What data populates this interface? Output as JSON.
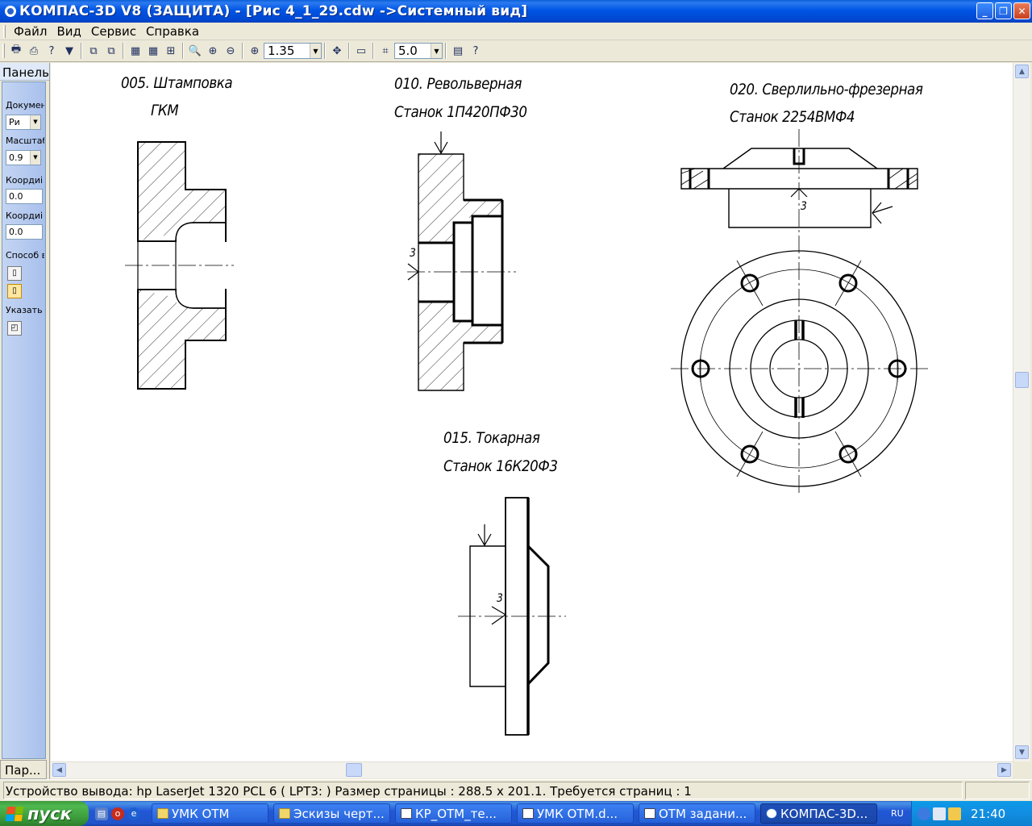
{
  "window": {
    "title": "КОМПАС-3D V8 (ЗАЩИТА) - [Рис 4_1_29.cdw ->Системный вид]"
  },
  "menu": [
    "Файл",
    "Вид",
    "Сервис",
    "Справка"
  ],
  "toolbar": {
    "zoom_value": "1.35",
    "step_value": "5.0"
  },
  "left_panel": {
    "header": "Панель",
    "doc_label": "Докумен",
    "doc_value": "Ри",
    "scale_label": "Масштаб",
    "scale_value": "0.9",
    "coord1_label": "Коордиі",
    "coord1_value": "0.0",
    "coord2_label": "Коордиі",
    "coord2_value": "0.0",
    "method_label": "Способ в",
    "specify_label": "Указать",
    "bottom_tab": "Пар..."
  },
  "drawing": {
    "op005_line1": "005. Штамповка",
    "op005_line2": "ГКМ",
    "op010_line1": "010. Револьверная",
    "op010_line2": "Станок 1П420ПФ30",
    "op015_line1": "015. Токарная",
    "op015_line2": "Станок 16К20Ф3",
    "op020_line1": "020. Сверлильно-фрезерная",
    "op020_line2": "Станок 2254ВМФ4",
    "mark3": "3"
  },
  "status": {
    "text": "Устройство вывода: hp LaserJet 1320 PCL 6 ( LPT3: )  Размер страницы : 288.5 x 201.1.   Требуется страниц : 1"
  },
  "taskbar": {
    "start_label": "пуск",
    "tasks": [
      "УМК ОТМ",
      "Эскизы черт...",
      "КР_ОТМ_те...",
      "УМК ОТМ.d...",
      "ОТМ задани...",
      "КОМПАС-3D..."
    ],
    "lang": "RU",
    "clock": "21:40"
  },
  "colors": {
    "titlebar": "#0055e5",
    "start": "#3a9a3a",
    "panel_blue": "#a8c0ec"
  }
}
